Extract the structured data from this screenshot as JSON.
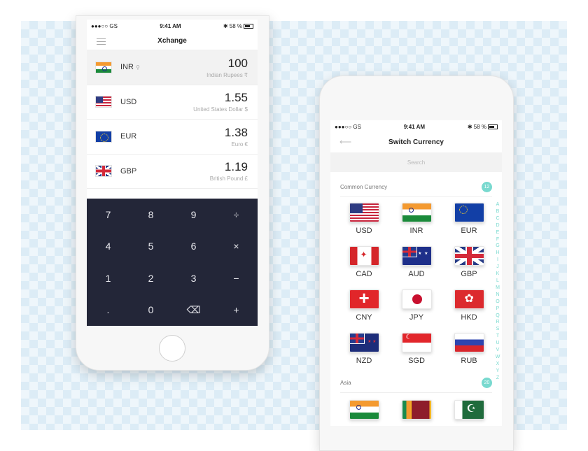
{
  "phone1": {
    "status": {
      "carrier": "●●●○○ GS",
      "time": "9:41 AM",
      "battery": "58 %"
    },
    "title": "Xchange",
    "rows": [
      {
        "code": "INR",
        "amount": "100",
        "name": "Indian Rupees ₹",
        "flag": "india-flag",
        "active": true,
        "pin": "location-pin-icon"
      },
      {
        "code": "USD",
        "amount": "1.55",
        "name": "United States Dollar $",
        "flag": "usa-flag"
      },
      {
        "code": "EUR",
        "amount": "1.38",
        "name": "Euro €",
        "flag": "eu-flag"
      },
      {
        "code": "GBP",
        "amount": "1.19",
        "name": "British Pound £",
        "flag": "uk-flag"
      }
    ],
    "keys": [
      "7",
      "8",
      "9",
      "÷",
      "4",
      "5",
      "6",
      "×",
      "1",
      "2",
      "3",
      "−",
      ".",
      "0",
      "⌫",
      "+"
    ]
  },
  "phone2": {
    "status": {
      "carrier": "●●●○○ GS",
      "time": "9:41 AM",
      "battery": "58 %"
    },
    "title": "Switch Currency",
    "back_icon": "back-arrow-icon",
    "search_placeholder": "Search",
    "common": {
      "label": "Common Currency",
      "count": "12",
      "currencies": [
        "USD",
        "INR",
        "EUR",
        "CAD",
        "AUD",
        "GBP",
        "CNY",
        "JPY",
        "HKD",
        "NZD",
        "SGD",
        "RUB"
      ]
    },
    "asia": {
      "label": "Asia",
      "count": "20"
    },
    "alphabet": [
      "A",
      "B",
      "C",
      "D",
      "E",
      "F",
      "G",
      "H",
      "I",
      "J",
      "K",
      "L",
      "M",
      "N",
      "O",
      "P",
      "Q",
      "R",
      "S",
      "T",
      "U",
      "V",
      "W",
      "X",
      "Y",
      "Z"
    ]
  },
  "colors": {
    "keypad_bg": "#232638",
    "accent": "#79d9cf"
  }
}
